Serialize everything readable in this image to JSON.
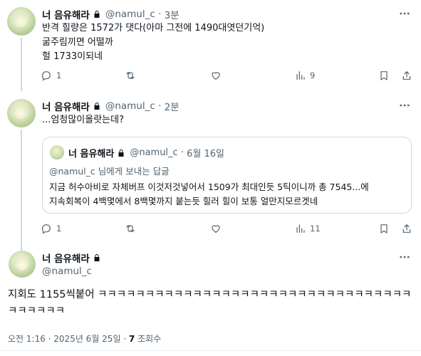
{
  "tweets": [
    {
      "name": "너 음유해라",
      "handle": "@namul_c",
      "time": "3분",
      "text": "반격 힐량은 1572가 댓다(아마 그전에 1490대엿던기억)\n굶주림끼면 어떨까\n헐 1733이되네",
      "reply_count": "1",
      "retweet_count": "",
      "view_count": "9"
    },
    {
      "name": "너 음유해라",
      "handle": "@namul_c",
      "time": "2분",
      "text": "...엄청많이올랏는데?",
      "reply_count": "1",
      "retweet_count": "",
      "view_count": "11",
      "quote": {
        "name": "너 음유해라",
        "handle": "@namul_c",
        "date": "6월 16일",
        "reply_to": "@namul_c 님에게 보내는 답글",
        "text": "지금 허수아비로 자체버프 이것저것넣어서 1509가 최대인듯 5틱이니까 총 7545...에\n지속회복이 4백몇에서 8백몇까지 붙는듯 힐러 힐이 보통 얼만지모르겟네"
      }
    }
  ],
  "main_tweet": {
    "name": "너 음유해라",
    "handle": "@namul_c",
    "text": "지회도 1155씩붙어 ㅋㅋㅋㅋㅋㅋㅋㅋㅋㅋㅋㅋㅋㅋㅋㅋㅋㅋㅋㅋㅋㅋㅋㅋㅋㅋㅋㅋㅋㅋㅋㅋㅋㅋㅋㅋㅋㅋㅋ",
    "timestamp": "오전 1:16 · 2025년 6월 25일 · ",
    "views_count": "7",
    "views_label": " 조회수"
  },
  "colors": {
    "text": "#0f1419",
    "secondary": "#536471",
    "border": "#cfd9de"
  },
  "icons": [
    "lock-icon",
    "more-icon",
    "reply-icon",
    "retweet-icon",
    "like-icon",
    "views-icon",
    "bookmark-icon",
    "share-icon"
  ]
}
